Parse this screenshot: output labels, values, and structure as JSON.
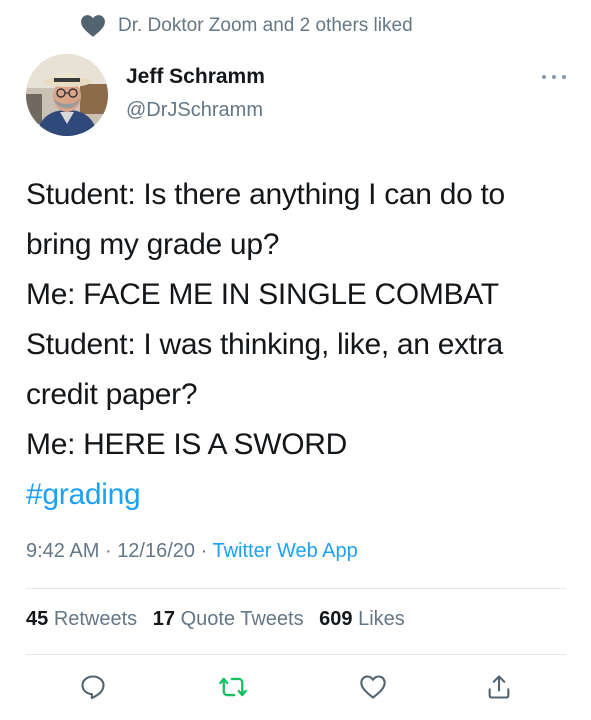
{
  "social_context": {
    "icon": "heart-icon",
    "text": "Dr. Doktor Zoom and 2 others liked"
  },
  "author": {
    "display_name": "Jeff Schramm",
    "handle": "@DrJSchramm"
  },
  "tweet": {
    "lines": [
      "Student: Is there anything I can do to",
      "bring my grade up?",
      "Me: FACE ME IN SINGLE COMBAT",
      "Student: I was thinking, like, an extra",
      "credit paper?",
      "Me: HERE IS A SWORD"
    ],
    "hashtag": "#grading"
  },
  "meta": {
    "time": "9:42 AM",
    "date": "12/16/20",
    "separator": "·",
    "source": "Twitter Web App"
  },
  "stats": {
    "retweets_count": "45",
    "retweets_label": "Retweets",
    "quotes_count": "17",
    "quotes_label": "Quote Tweets",
    "likes_count": "609",
    "likes_label": "Likes"
  },
  "actions": {
    "reply_icon": "speech-bubble-icon",
    "retweet_icon": "retweet-icon",
    "like_icon": "heart-outline-icon",
    "share_icon": "share-icon"
  },
  "colors": {
    "accent": "#1da1f2",
    "retweet": "#17bf63",
    "secondary_text": "#657786",
    "primary_text": "#14171a"
  }
}
